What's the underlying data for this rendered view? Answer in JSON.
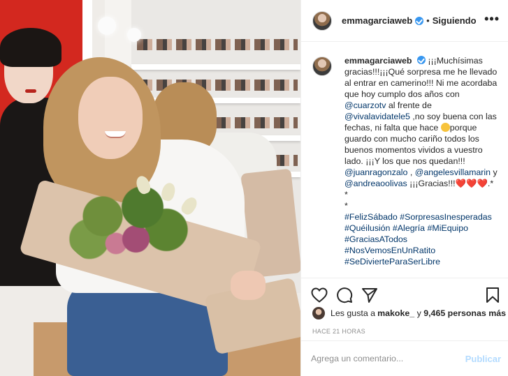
{
  "post": {
    "username": "emmagarciaweb",
    "follow_status": "Siguiendo",
    "header_separator": "•",
    "more_glyph": "•••"
  },
  "caption": {
    "username": "emmagarciaweb",
    "segments": [
      {
        "type": "text",
        "value": "¡¡¡Muchísimas gracias!!!¡¡¡Qué sorpresa me he llevado al entrar en camerino!!! Ni me acordaba que hoy cumplo dos años con "
      },
      {
        "type": "mention",
        "value": "@cuarzotv"
      },
      {
        "type": "text",
        "value": " al frente de "
      },
      {
        "type": "mention",
        "value": "@vivalavidatele5"
      },
      {
        "type": "text",
        "value": " ,no soy buena con las fechas, ni falta que hace "
      },
      {
        "type": "emoji",
        "value": "smiling-face-icon"
      },
      {
        "type": "text",
        "value": "porque guardo con mucho cariño todos los buenos momentos vividos a vuestro lado. ¡¡¡Y los que nos quedan!!! "
      },
      {
        "type": "mention",
        "value": "@juanragonzalo"
      },
      {
        "type": "text",
        "value": " , "
      },
      {
        "type": "mention",
        "value": "@angelesvillamarin"
      },
      {
        "type": "text",
        "value": " y "
      },
      {
        "type": "mention",
        "value": "@andreaoolivas"
      },
      {
        "type": "text",
        "value": " ¡¡¡Gracias!!!"
      },
      {
        "type": "heart",
        "value": "❤️"
      },
      {
        "type": "heart",
        "value": "❤️"
      },
      {
        "type": "heart",
        "value": "❤️"
      },
      {
        "type": "text",
        "value": ".*"
      }
    ],
    "separator_lines": [
      "*",
      "*"
    ],
    "hashtag_lines": [
      [
        "#FelizSábado",
        "#SorpresasInesperadas"
      ],
      [
        "#Quéilusión",
        "#Alegría",
        "#MiEquipo"
      ],
      [
        "#GraciasATodos"
      ],
      [
        "#NosVemosEnUnRatito"
      ],
      [
        "#SeDivierteParaSerLibre"
      ]
    ]
  },
  "actions": {
    "like_icon": "heart-outline-icon",
    "comment_icon": "comment-bubble-icon",
    "share_icon": "paper-plane-icon",
    "save_icon": "bookmark-icon"
  },
  "likes": {
    "prefix": "Les gusta a ",
    "first_user": "makoke_",
    "middle": " y ",
    "count_text": "9,465 personas más"
  },
  "timestamp": "HACE 21 HORAS",
  "comment_box": {
    "placeholder": "Agrega un comentario...",
    "publish_label": "Publicar"
  },
  "colors": {
    "link": "#003569",
    "verified": "#3897f0",
    "publish_disabled": "#b3dbff",
    "muted": "#8e8e8e"
  }
}
